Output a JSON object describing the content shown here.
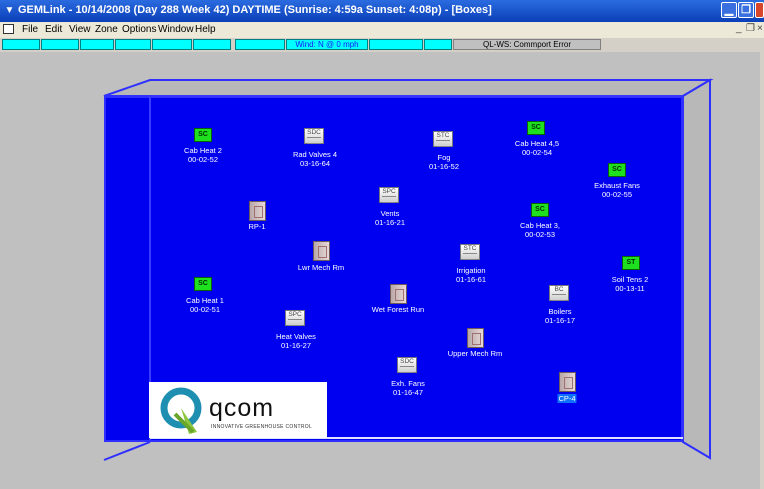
{
  "window": {
    "title": "GEMLink - 10/14/2008 (Day 288  Week 42) DAYTIME (Sunrise: 4:59a  Sunset: 4:08p) - [Boxes]"
  },
  "menu": {
    "items": [
      "File",
      "Edit",
      "View",
      "Zone",
      "Options",
      "Window",
      "Help"
    ]
  },
  "status": {
    "wind": "Wind: N @ 0 mph",
    "error": "QL-WS: Commport Error"
  },
  "devices": [
    {
      "type": "SC",
      "name": "Cab Heat 2",
      "address": "00-02-52"
    },
    {
      "type": "SDC",
      "name": "Rad Valves 4",
      "address": "03-16-64"
    },
    {
      "type": "STC",
      "name": "Fog",
      "address": "01-16-52"
    },
    {
      "type": "SC",
      "name": "Cab Heat 4,5",
      "address": "00-02-54"
    },
    {
      "type": "SC",
      "name": "Exhaust Fans",
      "address": "00-02-55"
    },
    {
      "type": "SPC",
      "name": "Vents",
      "address": "01-16-21"
    },
    {
      "type": "",
      "name": "RP-1",
      "address": ""
    },
    {
      "type": "SC",
      "name": "Cab Heat 3,",
      "address": "00-02-53"
    },
    {
      "type": "",
      "name": "Lwr Mech Rm",
      "address": ""
    },
    {
      "type": "STC",
      "name": "Irrigation",
      "address": "01-16-61"
    },
    {
      "type": "ST",
      "name": "Soil Tens 2",
      "address": "00-13-11"
    },
    {
      "type": "SC",
      "name": "Cab Heat 1",
      "address": "00-02-51"
    },
    {
      "type": "",
      "name": "Wet Forest Run",
      "address": ""
    },
    {
      "type": "BC",
      "name": "Boilers",
      "address": "01-16-17"
    },
    {
      "type": "SPC",
      "name": "Heat Valves",
      "address": "01-16-27"
    },
    {
      "type": "",
      "name": "Upper Mech Rm",
      "address": ""
    },
    {
      "type": "SDC",
      "name": "Exh. Fans",
      "address": "01-16-47"
    },
    {
      "type": "",
      "name": "CP-4",
      "address": ""
    }
  ],
  "logo": {
    "brand": "qcom",
    "tagline": "INNOVATIVE GREENHOUSE CONTROL"
  }
}
